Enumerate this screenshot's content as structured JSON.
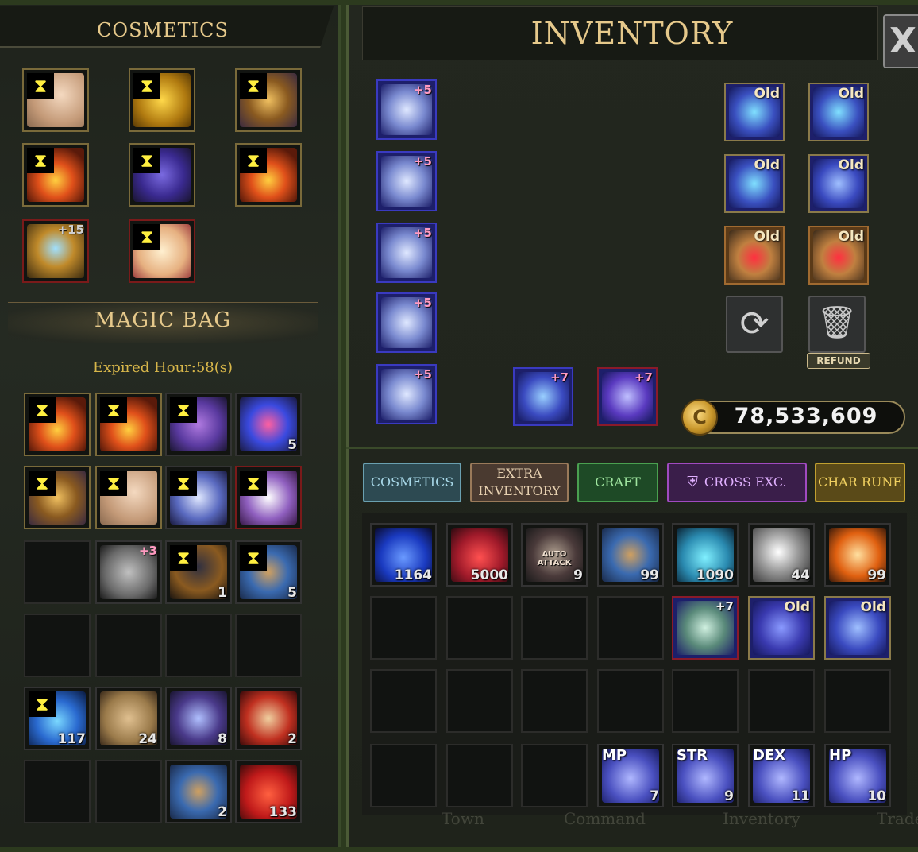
{
  "left_panel": {
    "title": "COSMETICS",
    "magic_bag_title": "MAGIC BAG",
    "expired_text": "Expired Hour:58(s)"
  },
  "right_panel": {
    "title": "INVENTORY",
    "close_label": "X",
    "refund_label": "REFUND",
    "gold": "78,533,609",
    "gold_icon": "C"
  },
  "tabs": {
    "cosmetics": "COSMETICS",
    "extra_inventory": "EXTRA INVENTORY",
    "craft": "CRAFT",
    "cross_exc": "CROSS EXC.",
    "char_rune": "CHAR RUNE"
  },
  "cosmetic_slots": {
    "badge_plus": "+15"
  },
  "equipment": {
    "helmet_plus": "+5",
    "armor_plus": "+5",
    "pants_plus": "+5",
    "gloves_plus": "+5",
    "boots_plus": "+5",
    "bow_plus": "+7",
    "dagger_plus": "+7",
    "old": "Old"
  },
  "magic_bag": {
    "ms_qty": "5",
    "boots_plus": "+3",
    "mirror_qty": "1",
    "scroll_qty": "5",
    "potion_qty": "117",
    "scroll_axes_qty": "24",
    "snake_qty": "8",
    "scroll_red_qty": "2",
    "scroll_blue_qty": "2",
    "red_potion_qty": "133"
  },
  "inventory": {
    "mana_qty": "1164",
    "redpots_qty": "5000",
    "voucher_qty": "9",
    "voucher_label": "AUTO ATTACK",
    "scroll_qty": "99",
    "tealpots_qty": "1090",
    "coin_qty": "44",
    "scroll_fire_qty": "99",
    "leaf_plus": "+7",
    "old": "Old",
    "rune_mp": "MP",
    "rune_mp_qty": "7",
    "rune_str": "STR",
    "rune_str_qty": "9",
    "rune_dex": "DEX",
    "rune_dex_qty": "11",
    "rune_hp": "HP",
    "rune_hp_qty": "10"
  },
  "background": {
    "town": "Town",
    "command": "Command",
    "inventory": "Inventory",
    "trade": "Trade"
  }
}
